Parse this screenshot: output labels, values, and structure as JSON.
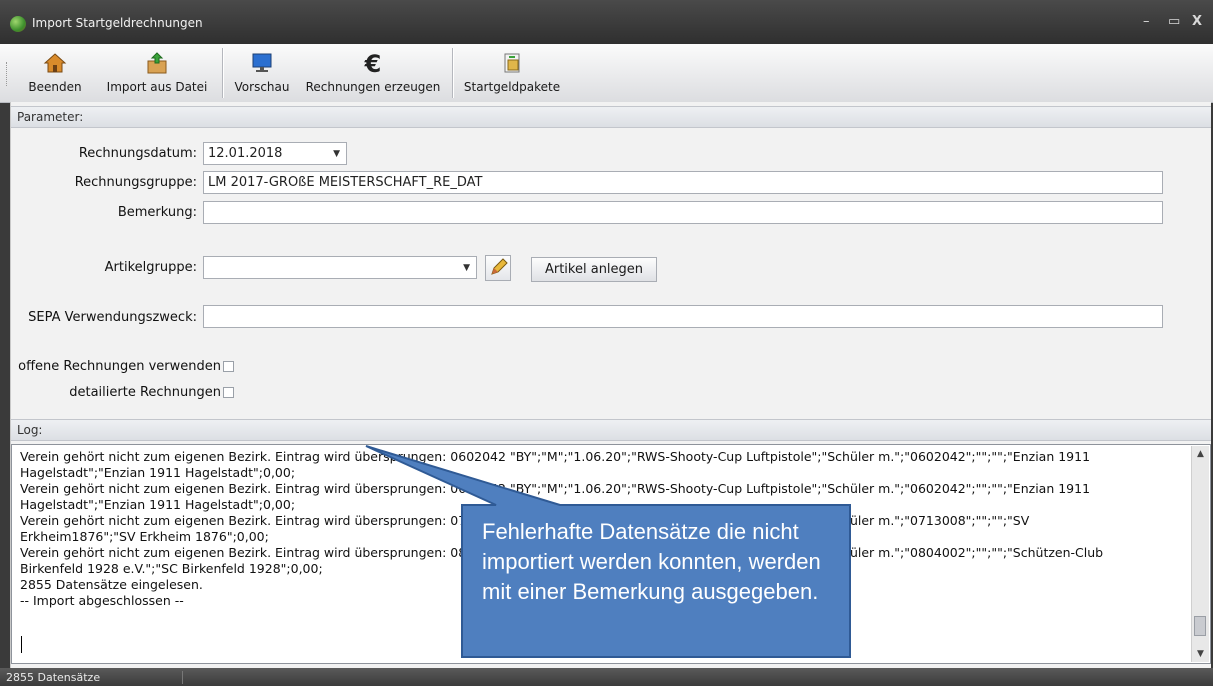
{
  "window": {
    "title": "Import Startgeldrechnungen",
    "controls": {
      "minimize": "–",
      "maximize": "▭",
      "close": "X"
    }
  },
  "toolbar": {
    "buttons": [
      {
        "label": "Beenden",
        "icon": "house-icon"
      },
      {
        "label": "Import aus Datei",
        "icon": "box-import-icon"
      },
      {
        "label": "Vorschau",
        "icon": "monitor-icon"
      },
      {
        "label": "Rechnungen erzeugen",
        "icon": "euro-icon"
      },
      {
        "label": "Startgeldpakete",
        "icon": "package-icon"
      }
    ]
  },
  "parameter": {
    "header": "Parameter:",
    "rechnungsdatum": {
      "label": "Rechnungsdatum:",
      "value": "12.01.2018"
    },
    "rechnungsgruppe": {
      "label": "Rechnungsgruppe:",
      "value": "LM 2017-GROßE MEISTERSCHAFT_RE_DAT"
    },
    "bemerkung": {
      "label": "Bemerkung:",
      "value": ""
    },
    "artikelgruppe": {
      "label": "Artikelgruppe:",
      "value": ""
    },
    "artikel_button": "Artikel anlegen",
    "sepa": {
      "label": "SEPA Verwendungszweck:",
      "value": ""
    },
    "offene_rechnungen": {
      "label": "offene Rechnungen verwenden",
      "checked": false
    },
    "detailierte_rechnungen": {
      "label": "detailierte Rechnungen",
      "checked": false
    }
  },
  "log": {
    "header": "Log:",
    "lines": [
      "Verein gehört nicht zum eigenen Bezirk. Eintrag wird übersprungen: 0602042 \"BY\";\"M\";\"1.06.20\";\"RWS-Shooty-Cup Luftpistole\";\"Schüler  m.\";\"0602042\";\"\";\"\";\"Enzian 1911",
      "Hagelstadt\";\"Enzian 1911 Hagelstadt\";0,00;",
      "Verein gehört nicht zum eigenen Bezirk. Eintrag wird übersprungen: 0602042 \"BY\";\"M\";\"1.06.20\";\"RWS-Shooty-Cup Luftpistole\";\"Schüler  m.\";\"0602042\";\"\";\"\";\"Enzian 1911",
      "Hagelstadt\";\"Enzian 1911 Hagelstadt\";0,00;",
      "Verein gehört nicht zum eigenen Bezirk. Eintrag wird übersprungen: 0713008 \"BY\";\"M\";\"1.06.20\";\"RWS-Shooty-Cup Luftpistole\";\"Schüler  m.\";\"0713008\";\"\";\"\";\"SV",
      "Erkheim1876\";\"SV Erkheim 1876\";0,00;",
      "Verein gehört nicht zum eigenen Bezirk. Eintrag wird übersprungen: 0804002 \"BY\";\"M\";\"1.06.20\";\"RWS-Shooty-Cup Luftpistole\";\"Schüler  m.\";\"0804002\";\"\";\"\";\"Schützen-Club",
      "Birkenfeld 1928 e.V.\";\"SC Birkenfeld 1928\";0,00;",
      "2855 Datensätze eingelesen.",
      " -- Import abgeschlossen --"
    ]
  },
  "callout": {
    "text": "Fehlerhafte Datensätze die nicht importiert werden konnten, werden mit einer Bemerkung ausgegeben.",
    "fill": "#4f7fbf",
    "border": "#2f5a95"
  },
  "status": {
    "text": "2855 Datensätze"
  }
}
